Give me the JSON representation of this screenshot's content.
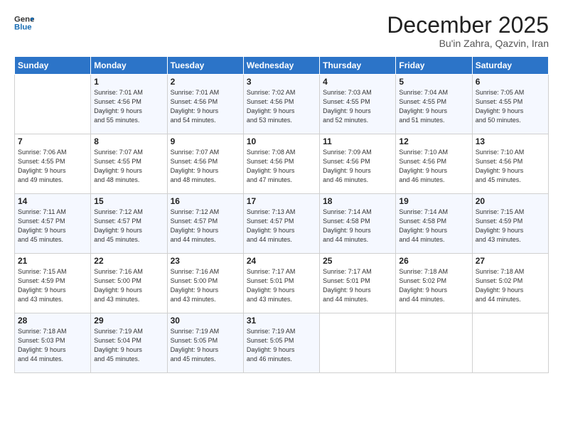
{
  "header": {
    "logo_line1": "General",
    "logo_line2": "Blue",
    "month": "December 2025",
    "location": "Bu'in Zahra, Qazvin, Iran"
  },
  "weekdays": [
    "Sunday",
    "Monday",
    "Tuesday",
    "Wednesday",
    "Thursday",
    "Friday",
    "Saturday"
  ],
  "weeks": [
    [
      {
        "day": "",
        "info": ""
      },
      {
        "day": "1",
        "info": "Sunrise: 7:01 AM\nSunset: 4:56 PM\nDaylight: 9 hours\nand 55 minutes."
      },
      {
        "day": "2",
        "info": "Sunrise: 7:01 AM\nSunset: 4:56 PM\nDaylight: 9 hours\nand 54 minutes."
      },
      {
        "day": "3",
        "info": "Sunrise: 7:02 AM\nSunset: 4:56 PM\nDaylight: 9 hours\nand 53 minutes."
      },
      {
        "day": "4",
        "info": "Sunrise: 7:03 AM\nSunset: 4:55 PM\nDaylight: 9 hours\nand 52 minutes."
      },
      {
        "day": "5",
        "info": "Sunrise: 7:04 AM\nSunset: 4:55 PM\nDaylight: 9 hours\nand 51 minutes."
      },
      {
        "day": "6",
        "info": "Sunrise: 7:05 AM\nSunset: 4:55 PM\nDaylight: 9 hours\nand 50 minutes."
      }
    ],
    [
      {
        "day": "7",
        "info": "Sunrise: 7:06 AM\nSunset: 4:55 PM\nDaylight: 9 hours\nand 49 minutes."
      },
      {
        "day": "8",
        "info": "Sunrise: 7:07 AM\nSunset: 4:55 PM\nDaylight: 9 hours\nand 48 minutes."
      },
      {
        "day": "9",
        "info": "Sunrise: 7:07 AM\nSunset: 4:56 PM\nDaylight: 9 hours\nand 48 minutes."
      },
      {
        "day": "10",
        "info": "Sunrise: 7:08 AM\nSunset: 4:56 PM\nDaylight: 9 hours\nand 47 minutes."
      },
      {
        "day": "11",
        "info": "Sunrise: 7:09 AM\nSunset: 4:56 PM\nDaylight: 9 hours\nand 46 minutes."
      },
      {
        "day": "12",
        "info": "Sunrise: 7:10 AM\nSunset: 4:56 PM\nDaylight: 9 hours\nand 46 minutes."
      },
      {
        "day": "13",
        "info": "Sunrise: 7:10 AM\nSunset: 4:56 PM\nDaylight: 9 hours\nand 45 minutes."
      }
    ],
    [
      {
        "day": "14",
        "info": "Sunrise: 7:11 AM\nSunset: 4:57 PM\nDaylight: 9 hours\nand 45 minutes."
      },
      {
        "day": "15",
        "info": "Sunrise: 7:12 AM\nSunset: 4:57 PM\nDaylight: 9 hours\nand 45 minutes."
      },
      {
        "day": "16",
        "info": "Sunrise: 7:12 AM\nSunset: 4:57 PM\nDaylight: 9 hours\nand 44 minutes."
      },
      {
        "day": "17",
        "info": "Sunrise: 7:13 AM\nSunset: 4:57 PM\nDaylight: 9 hours\nand 44 minutes."
      },
      {
        "day": "18",
        "info": "Sunrise: 7:14 AM\nSunset: 4:58 PM\nDaylight: 9 hours\nand 44 minutes."
      },
      {
        "day": "19",
        "info": "Sunrise: 7:14 AM\nSunset: 4:58 PM\nDaylight: 9 hours\nand 44 minutes."
      },
      {
        "day": "20",
        "info": "Sunrise: 7:15 AM\nSunset: 4:59 PM\nDaylight: 9 hours\nand 43 minutes."
      }
    ],
    [
      {
        "day": "21",
        "info": "Sunrise: 7:15 AM\nSunset: 4:59 PM\nDaylight: 9 hours\nand 43 minutes."
      },
      {
        "day": "22",
        "info": "Sunrise: 7:16 AM\nSunset: 5:00 PM\nDaylight: 9 hours\nand 43 minutes."
      },
      {
        "day": "23",
        "info": "Sunrise: 7:16 AM\nSunset: 5:00 PM\nDaylight: 9 hours\nand 43 minutes."
      },
      {
        "day": "24",
        "info": "Sunrise: 7:17 AM\nSunset: 5:01 PM\nDaylight: 9 hours\nand 43 minutes."
      },
      {
        "day": "25",
        "info": "Sunrise: 7:17 AM\nSunset: 5:01 PM\nDaylight: 9 hours\nand 44 minutes."
      },
      {
        "day": "26",
        "info": "Sunrise: 7:18 AM\nSunset: 5:02 PM\nDaylight: 9 hours\nand 44 minutes."
      },
      {
        "day": "27",
        "info": "Sunrise: 7:18 AM\nSunset: 5:02 PM\nDaylight: 9 hours\nand 44 minutes."
      }
    ],
    [
      {
        "day": "28",
        "info": "Sunrise: 7:18 AM\nSunset: 5:03 PM\nDaylight: 9 hours\nand 44 minutes."
      },
      {
        "day": "29",
        "info": "Sunrise: 7:19 AM\nSunset: 5:04 PM\nDaylight: 9 hours\nand 45 minutes."
      },
      {
        "day": "30",
        "info": "Sunrise: 7:19 AM\nSunset: 5:05 PM\nDaylight: 9 hours\nand 45 minutes."
      },
      {
        "day": "31",
        "info": "Sunrise: 7:19 AM\nSunset: 5:05 PM\nDaylight: 9 hours\nand 46 minutes."
      },
      {
        "day": "",
        "info": ""
      },
      {
        "day": "",
        "info": ""
      },
      {
        "day": "",
        "info": ""
      }
    ]
  ]
}
